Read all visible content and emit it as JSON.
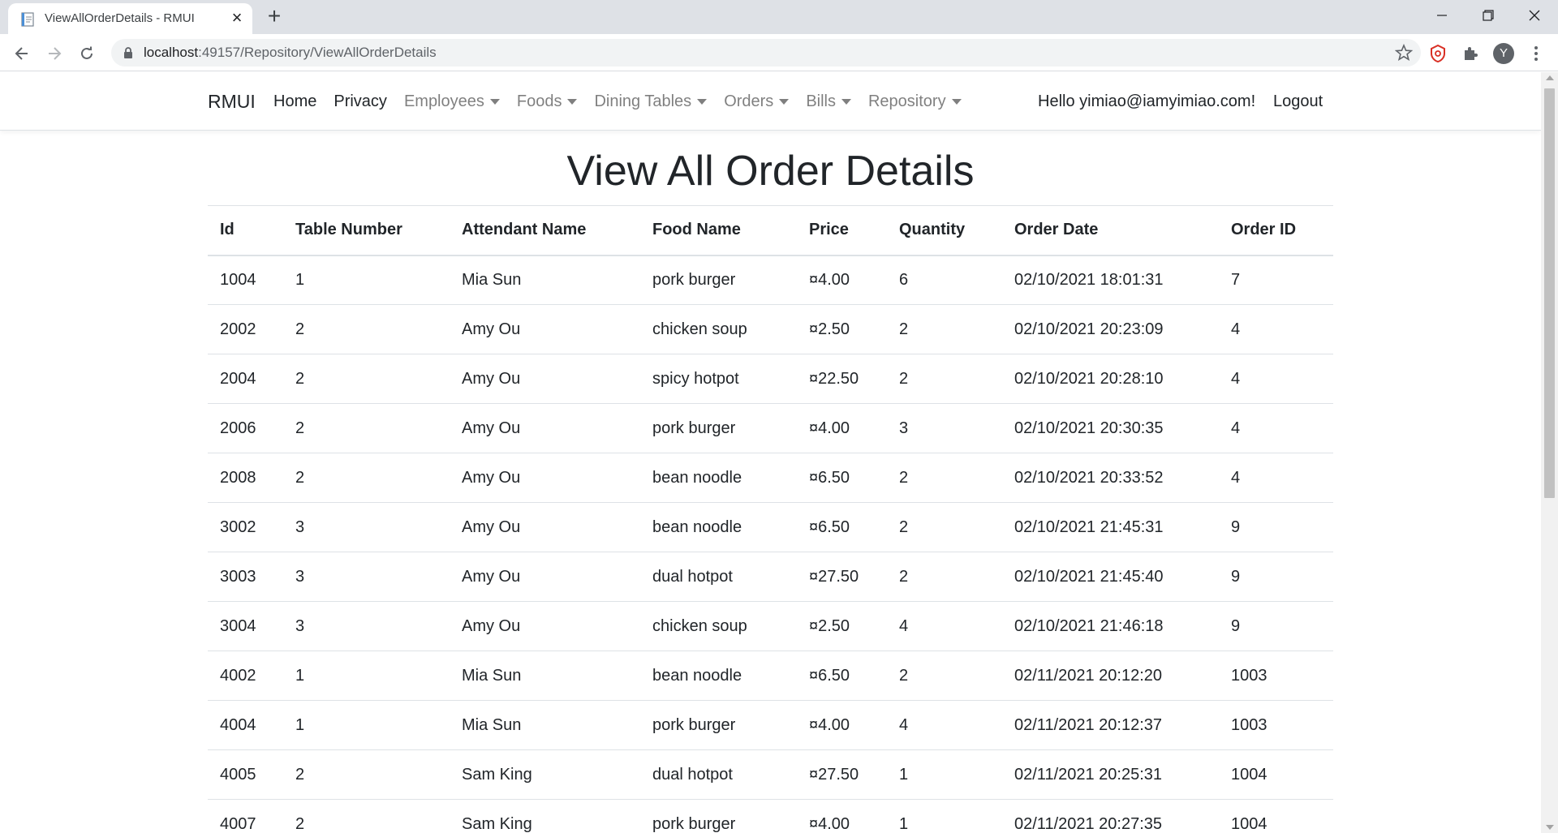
{
  "browser": {
    "tab_title": "ViewAllOrderDetails - RMUI",
    "url_host": "localhost",
    "url_path": ":49157/Repository/ViewAllOrderDetails",
    "avatar_letter": "Y"
  },
  "navbar": {
    "brand": "RMUI",
    "items": [
      {
        "label": "Home",
        "dropdown": false
      },
      {
        "label": "Privacy",
        "dropdown": false
      },
      {
        "label": "Employees",
        "dropdown": true
      },
      {
        "label": "Foods",
        "dropdown": true
      },
      {
        "label": "Dining Tables",
        "dropdown": true
      },
      {
        "label": "Orders",
        "dropdown": true
      },
      {
        "label": "Bills",
        "dropdown": true
      },
      {
        "label": "Repository",
        "dropdown": true
      }
    ],
    "greeting": "Hello yimiao@iamyimiao.com!",
    "logout": "Logout"
  },
  "page": {
    "title": "View All Order Details"
  },
  "table": {
    "headers": [
      "Id",
      "Table Number",
      "Attendant Name",
      "Food Name",
      "Price",
      "Quantity",
      "Order Date",
      "Order ID"
    ],
    "rows": [
      [
        "1004",
        "1",
        "Mia Sun",
        "pork burger",
        "¤4.00",
        "6",
        "02/10/2021 18:01:31",
        "7"
      ],
      [
        "2002",
        "2",
        "Amy Ou",
        "chicken soup",
        "¤2.50",
        "2",
        "02/10/2021 20:23:09",
        "4"
      ],
      [
        "2004",
        "2",
        "Amy Ou",
        "spicy hotpot",
        "¤22.50",
        "2",
        "02/10/2021 20:28:10",
        "4"
      ],
      [
        "2006",
        "2",
        "Amy Ou",
        "pork burger",
        "¤4.00",
        "3",
        "02/10/2021 20:30:35",
        "4"
      ],
      [
        "2008",
        "2",
        "Amy Ou",
        "bean noodle",
        "¤6.50",
        "2",
        "02/10/2021 20:33:52",
        "4"
      ],
      [
        "3002",
        "3",
        "Amy Ou",
        "bean noodle",
        "¤6.50",
        "2",
        "02/10/2021 21:45:31",
        "9"
      ],
      [
        "3003",
        "3",
        "Amy Ou",
        "dual hotpot",
        "¤27.50",
        "2",
        "02/10/2021 21:45:40",
        "9"
      ],
      [
        "3004",
        "3",
        "Amy Ou",
        "chicken soup",
        "¤2.50",
        "4",
        "02/10/2021 21:46:18",
        "9"
      ],
      [
        "4002",
        "1",
        "Mia Sun",
        "bean noodle",
        "¤6.50",
        "2",
        "02/11/2021 20:12:20",
        "1003"
      ],
      [
        "4004",
        "1",
        "Mia Sun",
        "pork burger",
        "¤4.00",
        "4",
        "02/11/2021 20:12:37",
        "1003"
      ],
      [
        "4005",
        "2",
        "Sam King",
        "dual hotpot",
        "¤27.50",
        "1",
        "02/11/2021 20:25:31",
        "1004"
      ],
      [
        "4007",
        "2",
        "Sam King",
        "pork burger",
        "¤4.00",
        "1",
        "02/11/2021 20:27:35",
        "1004"
      ]
    ]
  },
  "colors": {
    "tabstrip": "#dee1e6",
    "text": "#212529",
    "muted_nav": "#808080",
    "border": "#dee2e6",
    "ext_icon_red": "#d93025"
  }
}
